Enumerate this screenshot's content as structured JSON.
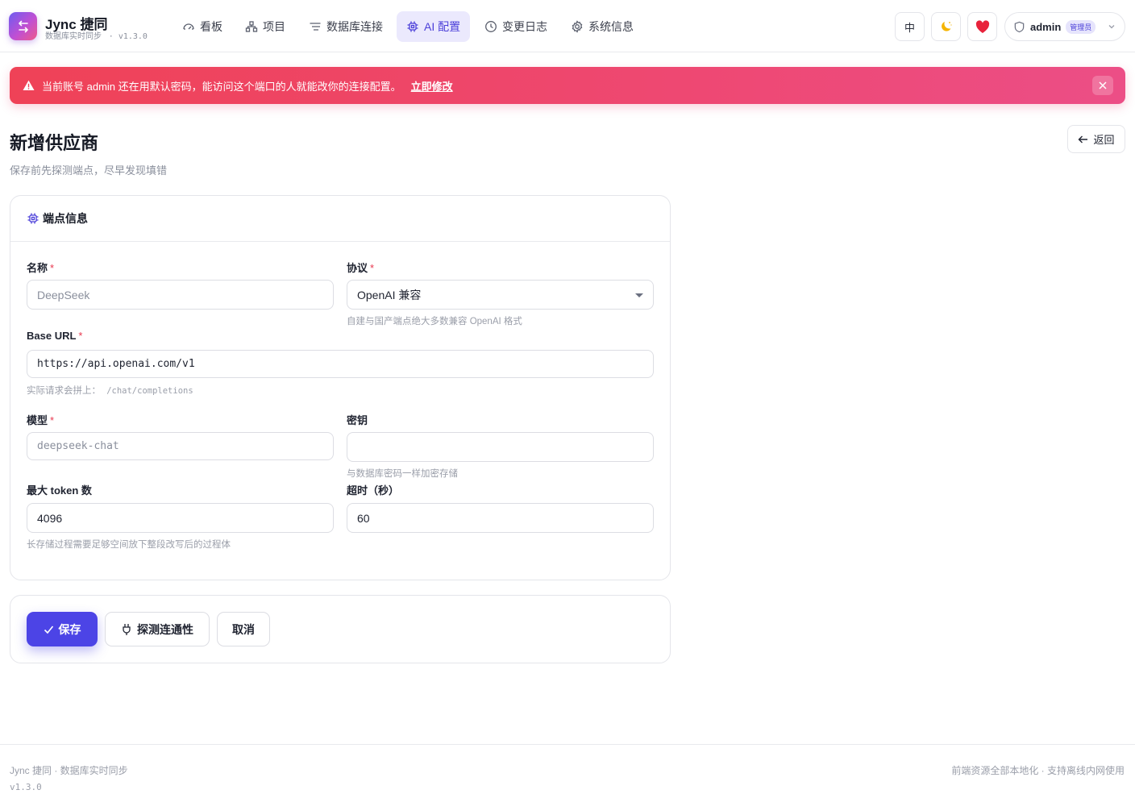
{
  "app": {
    "name": "Jync 捷同",
    "subtitle": "数据库实时同步",
    "version": "v1.3.0"
  },
  "nav": [
    {
      "label": "看板",
      "icon": "dashboard-icon"
    },
    {
      "label": "项目",
      "icon": "project-icon"
    },
    {
      "label": "数据库连接",
      "icon": "connection-icon"
    },
    {
      "label": "AI 配置",
      "icon": "chip-icon",
      "active": true
    },
    {
      "label": "变更日志",
      "icon": "clock-icon"
    },
    {
      "label": "系统信息",
      "icon": "gear-icon"
    }
  ],
  "header_right": {
    "language": "中",
    "theme_icon": "moon-icon",
    "heart_icon": "heart-icon",
    "user": "admin",
    "role": "管理员"
  },
  "alert": {
    "message": "当前账号 admin 还在用默认密码，能访问这个端口的人就能改你的连接配置。",
    "action": "立即修改"
  },
  "page": {
    "title": "新增供应商",
    "subtitle": "保存前先探测端点，尽早发现填错",
    "back": "返回"
  },
  "form": {
    "section_title": "端点信息",
    "name": {
      "label": "名称",
      "placeholder": "DeepSeek"
    },
    "protocol": {
      "label": "协议",
      "value": "OpenAI 兼容",
      "hint": "自建与国产端点绝大多数兼容 OpenAI 格式"
    },
    "base_url": {
      "label": "Base URL",
      "value": "https://api.openai.com/v1",
      "hint_prefix": "实际请求会拼上：",
      "hint_path": "/chat/completions"
    },
    "model": {
      "label": "模型",
      "placeholder": "deepseek-chat"
    },
    "secret": {
      "label": "密钥",
      "value": "",
      "hint": "与数据库密码一样加密存储"
    },
    "max_token": {
      "label": "最大 token 数",
      "value": "4096",
      "hint": "长存储过程需要足够空间放下整段改写后的过程体"
    },
    "timeout": {
      "label": "超时（秒）",
      "value": "60"
    }
  },
  "actions": {
    "save": "保存",
    "probe": "探测连通性",
    "cancel": "取消"
  },
  "footer": {
    "left": "Jync 捷同 · 数据库实时同步",
    "version": "v1.3.0",
    "right": "前端资源全部本地化 · 支持离线内网使用"
  },
  "colors": {
    "accent": "#4c44e6",
    "alert_start": "#ef4257",
    "alert_end": "#ec4e86",
    "required": "#e8384f"
  }
}
